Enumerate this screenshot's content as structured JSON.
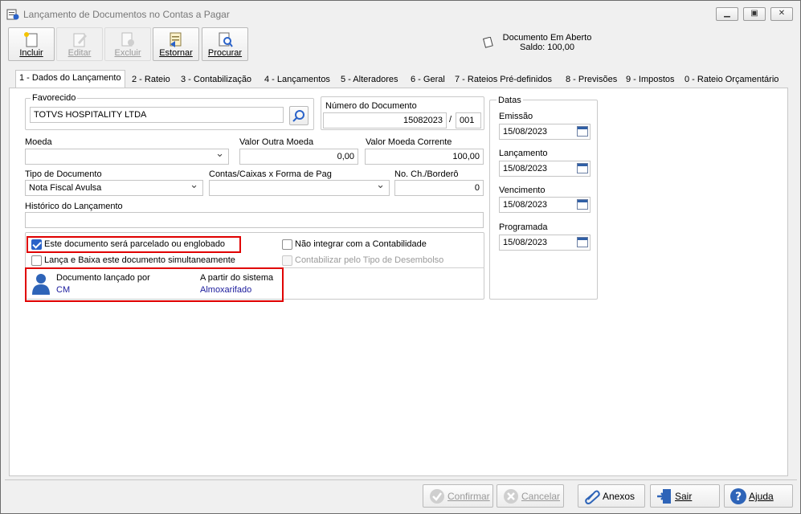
{
  "window": {
    "title": "Lançamento de Documentos no Contas a Pagar"
  },
  "toolbar": {
    "incluir": "Incluir",
    "editar": "Editar",
    "excluir": "Excluir",
    "estornar": "Estornar",
    "procurar": "Procurar"
  },
  "status": {
    "line1": "Documento Em Aberto",
    "line2": "Saldo: 100,00"
  },
  "tabs": [
    "1 - Dados do Lançamento",
    "2 - Rateio",
    "3 - Contabilização",
    "4 - Lançamentos",
    "5 - Alteradores",
    "6 - Geral",
    "7 - Rateios Pré-definidos",
    "8 - Previsões",
    "9 - Impostos",
    "0 - Rateio Orçamentário"
  ],
  "form": {
    "favorecido_label": "Favorecido",
    "favorecido_value": "TOTVS HOSPITALITY LTDA",
    "numero_label": "Número do Documento",
    "numero_value": "15082023",
    "numero_sep": "/",
    "numero_parcela": "001",
    "moeda_label": "Moeda",
    "moeda_value": "",
    "valor_outra_label": "Valor Outra Moeda",
    "valor_outra_value": "0,00",
    "valor_corrente_label": "Valor Moeda Corrente",
    "valor_corrente_value": "100,00",
    "tipo_doc_label": "Tipo de Documento",
    "tipo_doc_value": "Nota Fiscal Avulsa",
    "contas_label": "Contas/Caixas x Forma de Pag",
    "contas_value": "",
    "nocheque_label": "No. Ch./Borderô",
    "nocheque_value": "0",
    "historico_label": "Histórico do Lançamento",
    "historico_value": "",
    "chk_parcelado": "Este documento será parcelado ou englobado",
    "chk_lanca_baixa": "Lança e Baixa este documento simultaneamente",
    "chk_nao_integrar": "Não integrar com a Contabilidade",
    "chk_contabilizar": "Contabilizar pelo Tipo de Desembolso",
    "lancado_por_label": "Documento lançado por",
    "lancado_por_value": "CM",
    "sistema_label": "A partir do sistema",
    "sistema_value": "Almoxarifado"
  },
  "checks": {
    "parcelado": true,
    "lanca_baixa": false,
    "nao_integrar": false,
    "contabilizar": false
  },
  "datas": {
    "group_label": "Datas",
    "emissao_label": "Emissão",
    "emissao_value": "15/08/2023",
    "lancamento_label": "Lançamento",
    "lancamento_value": "15/08/2023",
    "vencimento_label": "Vencimento",
    "vencimento_value": "15/08/2023",
    "programada_label": "Programada",
    "programada_value": "15/08/2023"
  },
  "footer": {
    "confirmar": "Confirmar",
    "cancelar": "Cancelar",
    "anexos": "Anexos",
    "sair": "Sair",
    "ajuda": "Ajuda"
  },
  "colors": {
    "highlight": "#e00000",
    "link_blue": "#1a1a9c",
    "check_blue": "#2b63c9"
  }
}
